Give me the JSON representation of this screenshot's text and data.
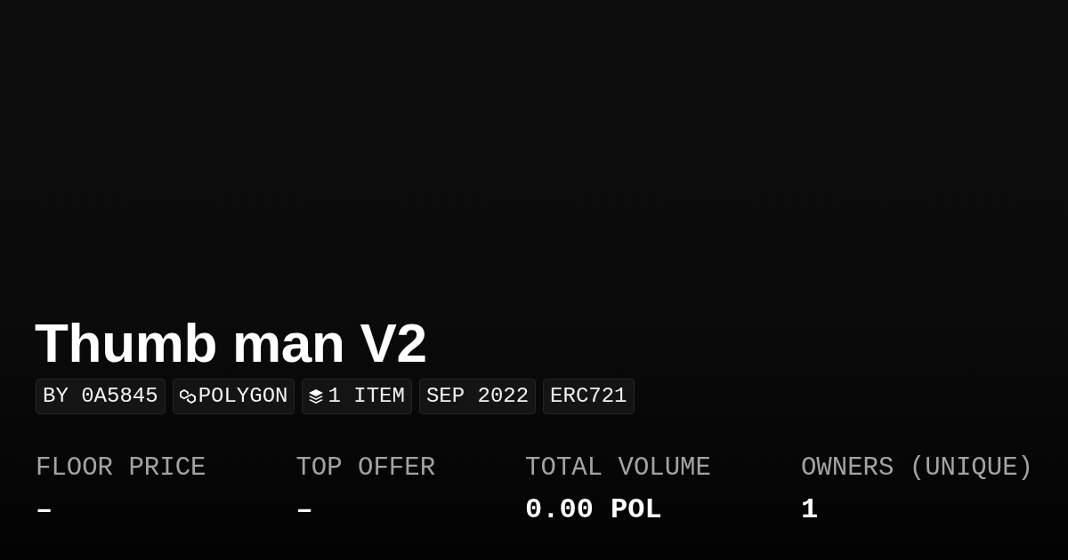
{
  "collection": {
    "title": "Thumb man V2",
    "tags": [
      {
        "kind": "creator",
        "label": "BY 0A5845"
      },
      {
        "kind": "chain",
        "label": "POLYGON"
      },
      {
        "kind": "items",
        "label": "1 ITEM"
      },
      {
        "kind": "date",
        "label": "SEP 2022"
      },
      {
        "kind": "standard",
        "label": "ERC721"
      }
    ]
  },
  "stats": [
    {
      "label": "FLOOR PRICE",
      "value": "–"
    },
    {
      "label": "TOP OFFER",
      "value": "–"
    },
    {
      "label": "TOTAL VOLUME",
      "value": "0.00 POL"
    },
    {
      "label": "OWNERS (UNIQUE)",
      "value": "1"
    }
  ]
}
